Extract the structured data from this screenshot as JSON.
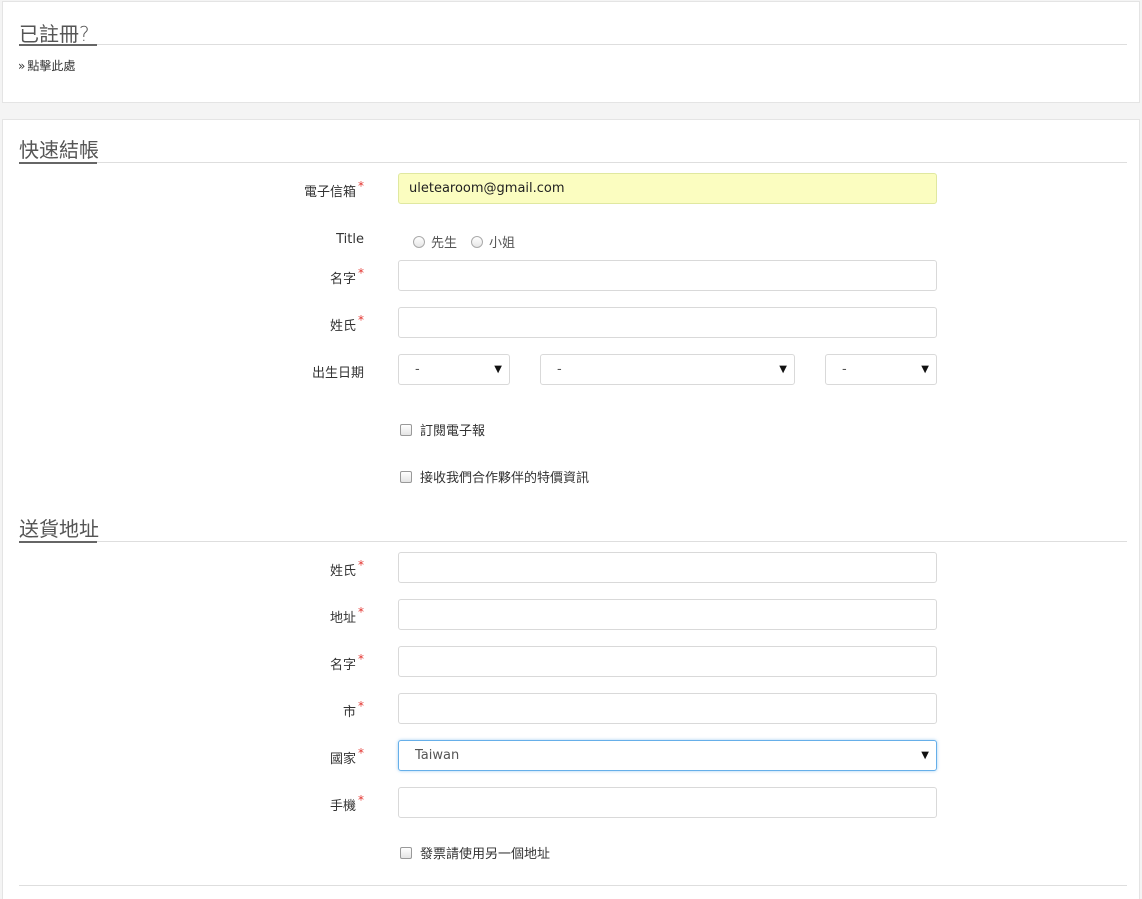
{
  "login": {
    "title": "已註冊?",
    "arrow": "»",
    "link_label": "點擊此處"
  },
  "checkout": {
    "title": "快速結帳",
    "email_label": "電子信箱",
    "email_value": "uletearoom@gmail.com",
    "title_label": "Title",
    "title_options": [
      "先生",
      "小姐"
    ],
    "firstname_label": "名字",
    "lastname_label": "姓氏",
    "birthdate_label": "出生日期",
    "birth_day": "-",
    "birth_month": "-",
    "birth_year": "-",
    "newsletter_label": "訂閱電子報",
    "partner_offers_label": "接收我們合作夥伴的特價資訊"
  },
  "shipping": {
    "title": "送貨地址",
    "lastname_label": "姓氏",
    "address_label": "地址",
    "firstname_label": "名字",
    "city_label": "市",
    "country_label": "國家",
    "country_value": "Taiwan",
    "mobile_label": "手機",
    "different_invoice_label": "發票請使用另一個地址"
  },
  "required_mark": "*",
  "caret": "▼",
  "colors": {
    "required": "#e3342f",
    "autofill": "#fbfdc0",
    "focus": "#66afe9"
  }
}
